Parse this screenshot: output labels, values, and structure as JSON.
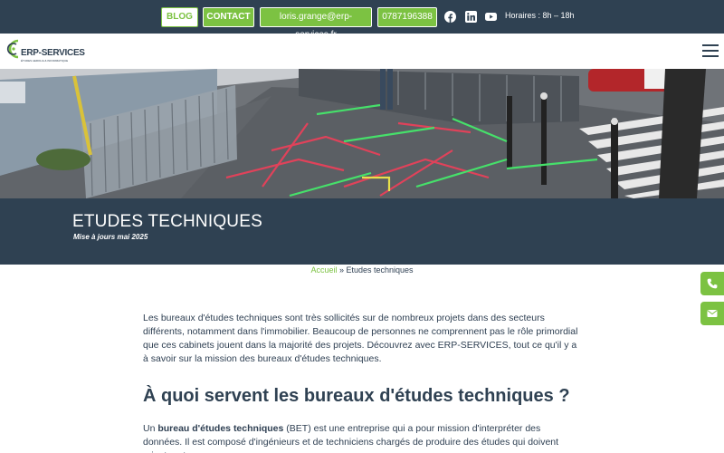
{
  "topbar": {
    "blog": "BLOG",
    "contact": "CONTACT",
    "email": "loris.grange@erp-services.fr",
    "phone": "0787196388",
    "hours": "Horaires : 8h – 18h",
    "social": [
      "facebook-icon",
      "linkedin-icon",
      "youtube-icon"
    ]
  },
  "header": {
    "logo_text": "ERP-SERVICES",
    "logo_tagline": "ÉTUDES AEROLIA & INFORMATIQUE"
  },
  "banner": {
    "title": "ETUDES TECHNIQUES",
    "subtitle": "Mise à jours mai 2025"
  },
  "breadcrumb": {
    "home": "Accueil",
    "separator": " » ",
    "current": "Etudes techniques"
  },
  "article": {
    "intro": "Les bureaux d'études techniques sont très sollicités sur de nombreux projets dans des secteurs différents, notamment dans l'immobilier. Beaucoup de personnes ne comprennent pas le rôle primordial que ces cabinets jouent dans la majorité des projets. Découvrez avec ERP-SERVICES, tout ce qu'il y a à savoir sur la mission des bureaux d'études techniques.",
    "heading": "À quoi servent les bureaux d'études techniques ?",
    "p2_before": "Un ",
    "p2_bold": "bureau d'études techniques",
    "p2_after": " (BET) est une entreprise qui a pour mission d'interpréter des données. Il est composé d'ingénieurs et de techniciens chargés de produire des études qui doivent orienter et"
  },
  "floating": [
    "phone-icon",
    "mail-icon"
  ],
  "colors": {
    "accent": "#7cc242",
    "navy": "#2f4152",
    "text": "#2e3f52"
  }
}
